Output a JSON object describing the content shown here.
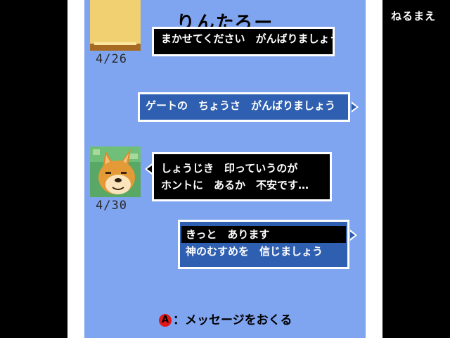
{
  "top_right_label": "ねるまえ",
  "title": "りんたろー",
  "colors": {
    "screen_bg": "#7fa4f0",
    "button_blue": "#2f5fb0",
    "a_button": "#e01818"
  },
  "messages": {
    "partial_top_text": "まかせてください　がんばりましょう",
    "partial_top_date": "4/26",
    "reply1": "ゲートの　ちょうさ　がんばりましょう",
    "message2_line1": "しょうじき　印っていうのが",
    "message2_line2": "ホントに　あるか　不安です…",
    "message2_date": "4/30"
  },
  "choices": [
    "きっと　あります",
    "神のむすめを　信じましょう"
  ],
  "footer": {
    "button": "A",
    "text": "：メッセージをおくる"
  }
}
